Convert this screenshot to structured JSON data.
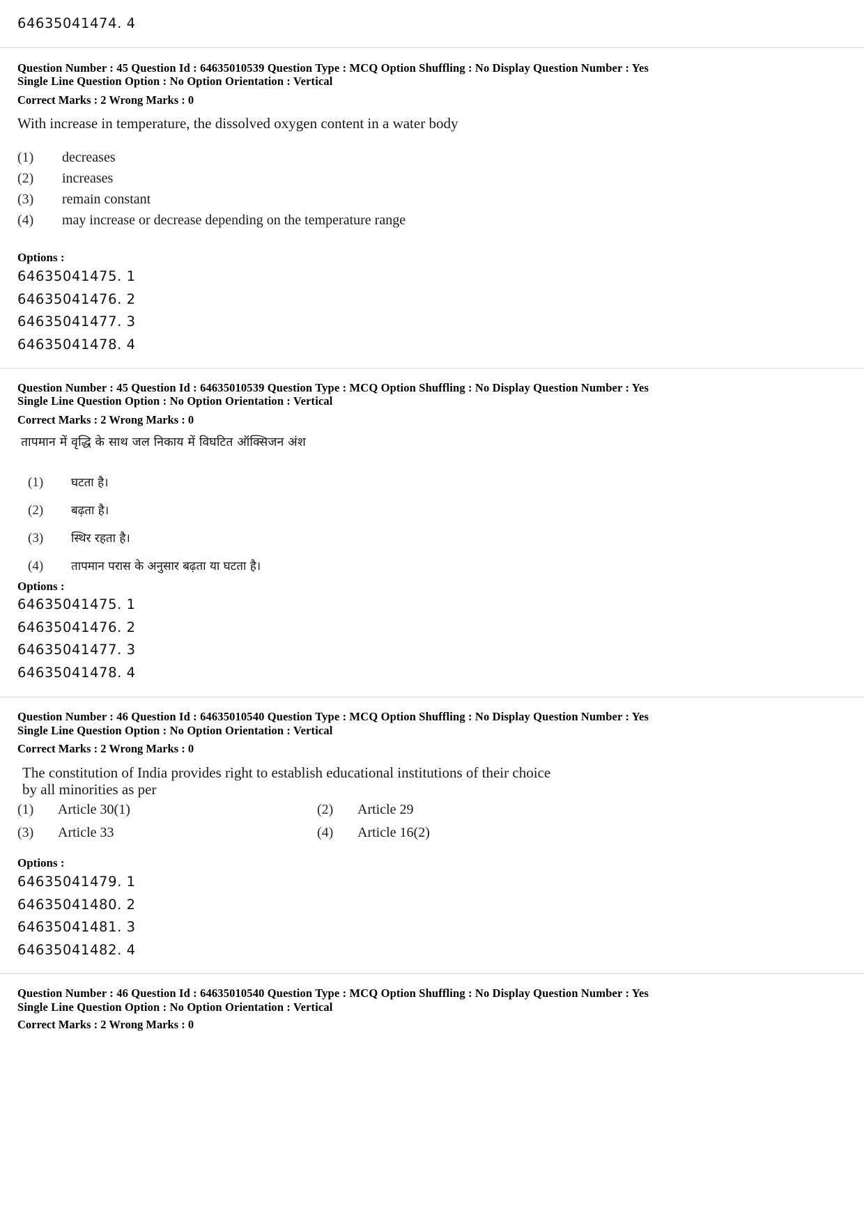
{
  "page": {
    "top_orphan_option_id": "64635041474. 4",
    "options_label": "Options :"
  },
  "blocks": [
    {
      "id": "q45-en",
      "meta": {
        "line1": "Question Number : 45  Question Id : 64635010539  Question Type : MCQ  Option Shuffling : No  Display Question Number : Yes",
        "line2": "Single Line Question Option : No  Option Orientation : Vertical",
        "marks": "Correct Marks : 2  Wrong Marks : 0"
      },
      "question": "With increase in temperature, the dissolved oxygen content in a water body",
      "choices": [
        {
          "num": "(1)",
          "text": "decreases"
        },
        {
          "num": "(2)",
          "text": "increases"
        },
        {
          "num": "(3)",
          "text": "remain constant"
        },
        {
          "num": "(4)",
          "text": "may increase or decrease depending on the temperature range"
        }
      ],
      "options_label": "Options :",
      "option_ids": [
        "64635041475. 1",
        "64635041476. 2",
        "64635041477. 3",
        "64635041478. 4"
      ]
    },
    {
      "id": "q45-hi",
      "meta": {
        "line1": "Question Number : 45  Question Id : 64635010539  Question Type : MCQ  Option Shuffling : No  Display Question Number : Yes",
        "line2": "Single Line Question Option : No  Option Orientation : Vertical",
        "marks": "Correct Marks : 2  Wrong Marks : 0"
      },
      "question": "तापमान में वृद्धि के साथ जल निकाय में विघटित ऑक्सिजन अंश",
      "choices": [
        {
          "num": "(1)",
          "text": "घटता है।"
        },
        {
          "num": "(2)",
          "text": "बढ़ता है।"
        },
        {
          "num": "(3)",
          "text": "स्थिर रहता है।"
        },
        {
          "num": "(4)",
          "text": "तापमान परास के अनुसार बढ़ता या घटता है।"
        }
      ],
      "options_label": "Options :",
      "option_ids": [
        "64635041475. 1",
        "64635041476. 2",
        "64635041477. 3",
        "64635041478. 4"
      ]
    },
    {
      "id": "q46-en",
      "meta": {
        "line1": "Question Number : 46  Question Id : 64635010540  Question Type : MCQ  Option Shuffling : No  Display Question Number : Yes",
        "line2": "Single Line Question Option : No  Option Orientation : Vertical",
        "marks": "Correct Marks : 2  Wrong Marks : 0"
      },
      "question_line1": "The constitution of India provides right to establish educational institutions of their choice",
      "question_line2": "by all minorities as per",
      "choices": [
        {
          "num": "(1)",
          "text": "Article 30(1)"
        },
        {
          "num": "(2)",
          "text": "Article 29"
        },
        {
          "num": "(3)",
          "text": "Article 33"
        },
        {
          "num": "(4)",
          "text": "Article 16(2)"
        }
      ],
      "options_label": "Options :",
      "option_ids": [
        "64635041479. 1",
        "64635041480. 2",
        "64635041481. 3",
        "64635041482. 4"
      ]
    },
    {
      "id": "q46-hi",
      "meta": {
        "line1": "Question Number : 46  Question Id : 64635010540  Question Type : MCQ  Option Shuffling : No  Display Question Number : Yes",
        "line2": "Single Line Question Option : No  Option Orientation : Vertical",
        "marks": "Correct Marks : 2  Wrong Marks : 0"
      }
    }
  ]
}
